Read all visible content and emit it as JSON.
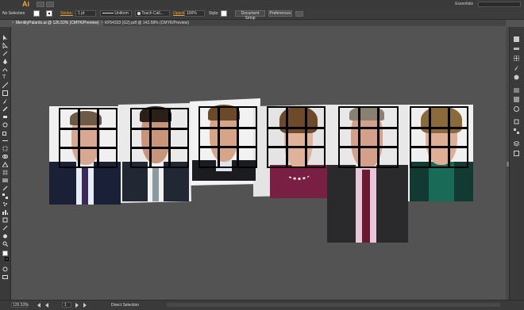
{
  "app": {
    "logo": "Ai",
    "workspace": "Essentials"
  },
  "control_bar": {
    "selection": "No Selection",
    "stroke_label": "Stroke:",
    "stroke_weight": "1 pt",
    "stroke_profile": "Uniform",
    "brush": "Touch Call...",
    "opacity_label": "Opacity:",
    "opacity_value": "100%",
    "style_label": "Style:",
    "document_setup": "Document Setup",
    "preferences": "Preferences"
  },
  "tabs": [
    {
      "label": "MentityPalardo.ai @ 126.53% (CMYK/Preview)",
      "active": true
    },
    {
      "label": "KF54333 (G2).pdf @ 142.58% (CMYK/Preview)",
      "active": false
    }
  ],
  "status_bar": {
    "zoom": "126.53%",
    "page": "1",
    "tool": "Direct Selection"
  },
  "colors": {
    "accent": "#f0a030",
    "canvas": "#535353",
    "artboard": "#e8e8e8",
    "grid_lines": "#000000"
  },
  "artwork": {
    "portraits": [
      {
        "name": "portrait-1",
        "suit": "#1a2036",
        "shirt": "#e8eef5",
        "tie": "#3c2a5a",
        "hair": "#6b5a45"
      },
      {
        "name": "portrait-2",
        "suit": "#222833",
        "shirt": "#f2f2f2",
        "tie": "#8a9aa0",
        "hair": "#2a2018"
      },
      {
        "name": "portrait-3",
        "suit": "#1b1c20",
        "shirt": "#dde3ea",
        "tie": "#1b1c20",
        "hair": "#6b4a2a"
      },
      {
        "name": "portrait-4",
        "suit": "#7a1f44",
        "shirt": "#7a1f44",
        "tie": "#7a1f44",
        "hair": "#6e4a2a"
      },
      {
        "name": "portrait-5",
        "suit": "#2a2a2c",
        "shirt": "#e8c8d8",
        "tie": "#6a1a30",
        "hair": "#8a8070"
      },
      {
        "name": "portrait-6",
        "suit": "#123a32",
        "shirt": "#1a6a58",
        "tie": "#1a6a58",
        "hair": "#8a6a3a"
      }
    ]
  }
}
